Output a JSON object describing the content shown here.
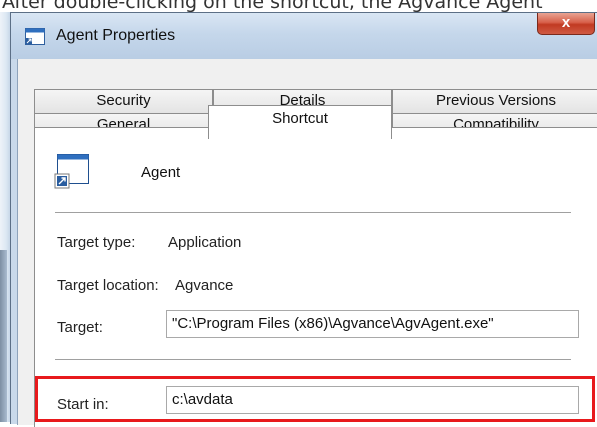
{
  "caption": "After double-clicking on the shortcut, the Agvance Agent",
  "window": {
    "title": "Agent Properties",
    "close_label": "x",
    "icon": "window-app-icon"
  },
  "tabs": {
    "row1": [
      "Security",
      "Details",
      "Previous Versions"
    ],
    "row2": [
      "General",
      "Shortcut",
      "Compatibility"
    ],
    "active": "Shortcut"
  },
  "shortcut": {
    "name": "Agent",
    "icon": "shortcut-icon",
    "target_type_label": "Target type:",
    "target_type_value": "Application",
    "target_location_label": "Target location:",
    "target_location_value": "Agvance",
    "target_label": "Target:",
    "target_value": "\"C:\\Program Files (x86)\\Agvance\\AgvAgent.exe\"",
    "start_in_label": "Start in:",
    "start_in_value": "c:\\avdata"
  },
  "colors": {
    "highlight": "#e8191c",
    "titlebar": "#c5d7eb",
    "close_button": "#c13a22"
  }
}
